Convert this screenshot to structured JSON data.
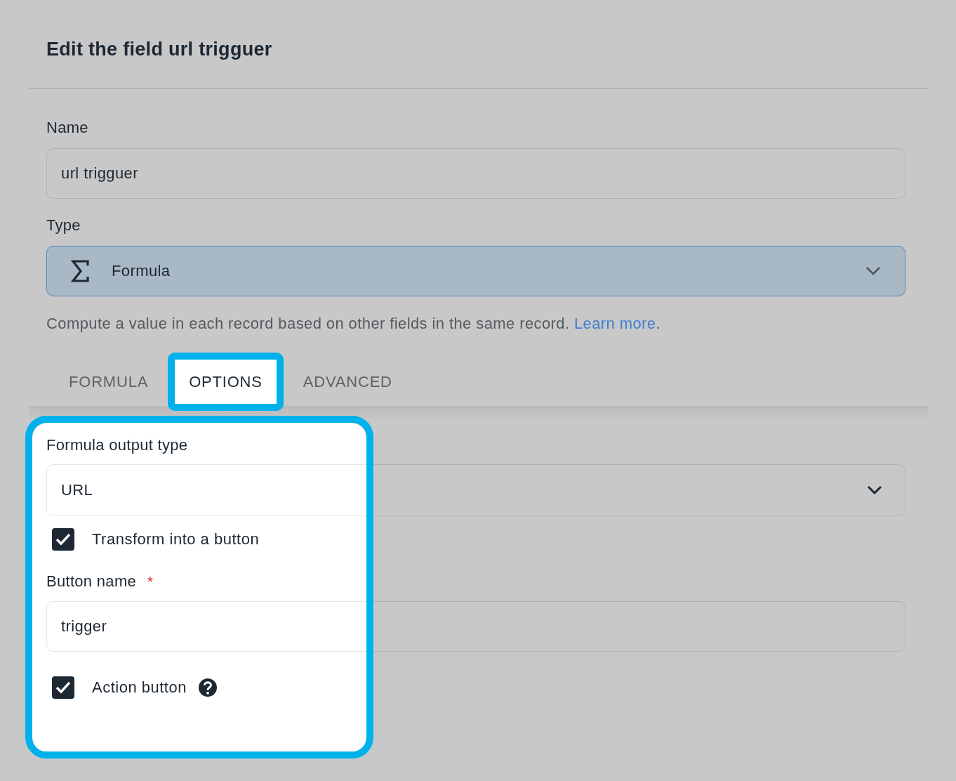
{
  "dialog": {
    "title": "Edit the field url trigguer"
  },
  "name_field": {
    "label": "Name",
    "value": "url trigguer"
  },
  "type_field": {
    "label": "Type",
    "value": "Formula"
  },
  "description": {
    "text": "Compute a value in each record based on other fields in the same record.",
    "link": "Learn more",
    "end": "."
  },
  "tabs": [
    {
      "label": "FORMULA",
      "selected": false
    },
    {
      "label": "OPTIONS",
      "selected": true
    },
    {
      "label": "ADVANCED",
      "selected": false
    }
  ],
  "options": {
    "output_type": {
      "label": "Formula output type",
      "value": "URL"
    },
    "transform": {
      "label": "Transform into a button",
      "checked": true
    },
    "button_name": {
      "label": "Button name",
      "required_mark": "*",
      "value": "trigger"
    },
    "action_button": {
      "label": "Action button",
      "checked": true
    }
  }
}
